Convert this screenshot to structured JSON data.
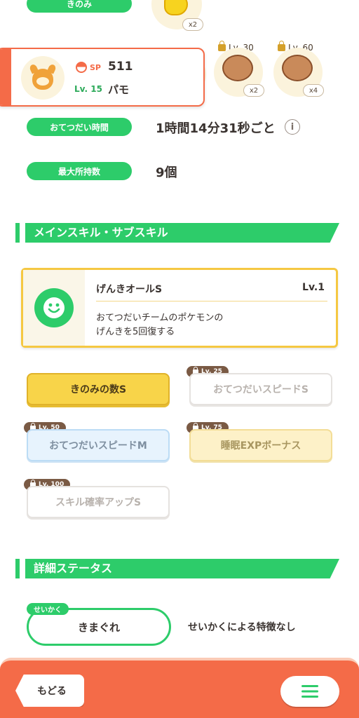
{
  "top": {
    "berry_label": "きのみ",
    "berry_count": "x2",
    "ingredients": [
      {
        "lock_level": "Lv. 30",
        "count": "x2",
        "icon": "cacao-icon"
      },
      {
        "lock_level": "Lv. 60",
        "count": "x4",
        "icon": "cacao-icon"
      }
    ]
  },
  "pokemon": {
    "sp_label": "SP",
    "sp_value": "511",
    "level": "Lv. 15",
    "name": "パモ"
  },
  "stats": {
    "help_time_label": "おてつだい時間",
    "help_time_value": "1時間14分31秒ごと",
    "max_carry_label": "最大所持数",
    "max_carry_value": "9個"
  },
  "skills_section": {
    "title": "メインスキル・サブスキル",
    "main_skill": {
      "name": "げんきオールS",
      "level": "Lv.1",
      "desc_line1": "おてつだいチームのポケモンの",
      "desc_line2": "げんきを5回復する"
    },
    "sub_skills": [
      {
        "label": "きのみの数S",
        "lock": ""
      },
      {
        "label": "おてつだいスピードS",
        "lock": "Lv. 25"
      },
      {
        "label": "おてつだいスピードM",
        "lock": "Lv. 50"
      },
      {
        "label": "睡眠EXPボーナス",
        "lock": "Lv. 75"
      },
      {
        "label": "スキル確率アップS",
        "lock": "Lv. 100"
      }
    ]
  },
  "details_section": {
    "title": "詳細ステータス",
    "nature_tag": "せいかく",
    "nature_value": "きまぐれ",
    "nature_effect": "せいかくによる特徴なし"
  },
  "footer": {
    "back_label": "もどる"
  },
  "colors": {
    "green": "#2dcc6a",
    "orange": "#f46b48",
    "gold": "#f5c842"
  }
}
